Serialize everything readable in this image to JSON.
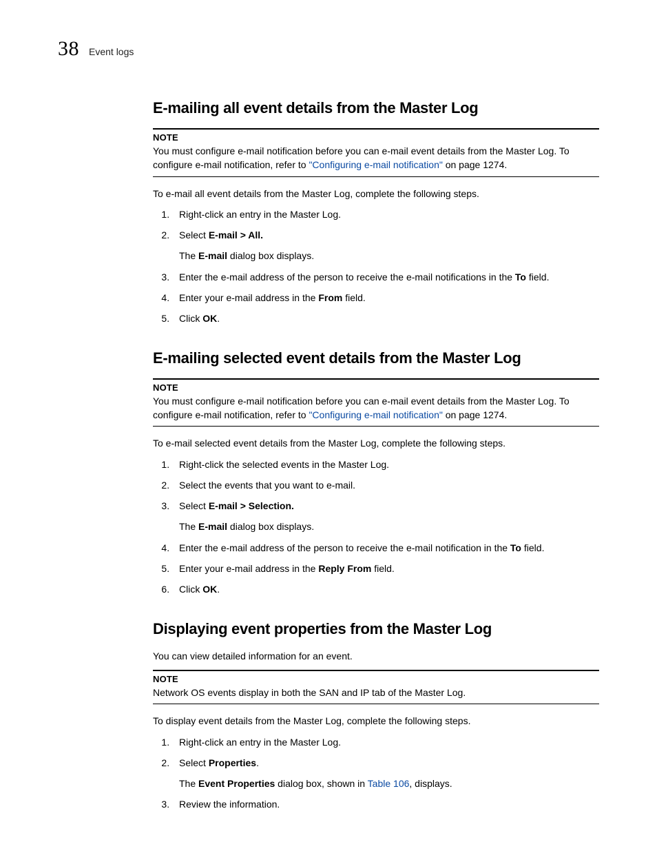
{
  "header": {
    "page_number": "38",
    "running_title": "Event logs"
  },
  "sections": [
    {
      "heading": "E-mailing all event details from the Master Log",
      "note_label": "NOTE",
      "note_pre": "You must configure e-mail notification before you can e-mail event details from the Master Log. To configure e-mail notification, refer to ",
      "note_link": "\"Configuring e-mail notification\"",
      "note_post": " on page 1274.",
      "intro": "To e-mail all event details from the Master Log, complete the following steps.",
      "steps": [
        {
          "t": "Right-click an entry in the Master Log."
        },
        {
          "pre": "Select ",
          "b": "E-mail > All.",
          "post": "",
          "sub_pre": "The ",
          "sub_b": "E-mail",
          "sub_post": " dialog box displays."
        },
        {
          "pre": "Enter the e-mail address of the person to receive the e-mail notifications in the ",
          "b": "To",
          "post": " field."
        },
        {
          "pre": "Enter your e-mail address in the ",
          "b": "From",
          "post": " field."
        },
        {
          "pre": "Click ",
          "b": "OK",
          "post": "."
        }
      ]
    },
    {
      "heading": "E-mailing selected event details from the Master Log",
      "note_label": "NOTE",
      "note_pre": "You must configure e-mail notification before you can e-mail event details from the Master Log. To configure e-mail notification, refer to ",
      "note_link": "\"Configuring e-mail notification\"",
      "note_post": " on page 1274.",
      "intro": "To e-mail selected event details from the Master Log, complete the following steps.",
      "steps": [
        {
          "t": "Right-click the selected events in the Master Log."
        },
        {
          "t": "Select the events that you want to e-mail."
        },
        {
          "pre": "Select ",
          "b": "E-mail > Selection.",
          "post": "",
          "sub_pre": "The ",
          "sub_b": "E-mail",
          "sub_post": " dialog box displays."
        },
        {
          "pre": "Enter the e-mail address of the person to receive the e-mail notification in the ",
          "b": "To",
          "post": " field."
        },
        {
          "pre": "Enter your e-mail address in the ",
          "b": "Reply From",
          "post": " field."
        },
        {
          "pre": "Click ",
          "b": "OK",
          "post": "."
        }
      ]
    },
    {
      "heading": "Displaying event properties from the Master Log",
      "prebody": "You can view detailed information for an event.",
      "note_label": "NOTE",
      "note_pre": "Network OS events display in both the SAN and IP tab of the Master Log.",
      "intro": "To display event details from the Master Log, complete the following steps.",
      "steps": [
        {
          "t": "Right-click an entry in the Master Log."
        },
        {
          "pre": "Select ",
          "b": "Properties",
          "post": ".",
          "sub_pre": "The ",
          "sub_b": "Event Properties",
          "sub_post_pre": " dialog box, shown in ",
          "sub_link": "Table 106",
          "sub_post": ", displays."
        },
        {
          "t": "Review the information."
        }
      ]
    }
  ]
}
